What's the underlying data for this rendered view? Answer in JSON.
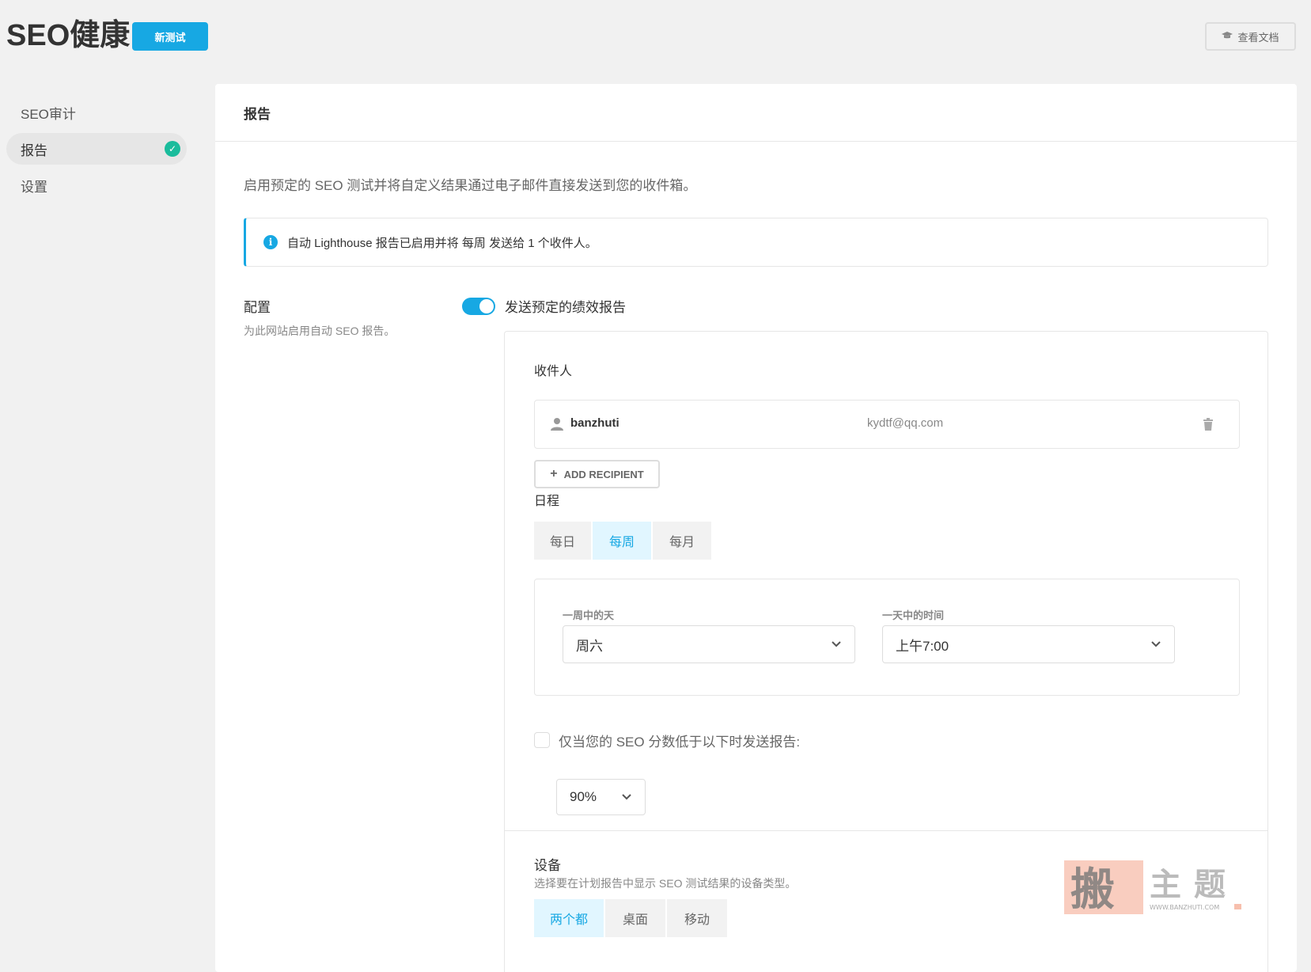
{
  "header": {
    "title": "SEO健康",
    "new_test_label": "新测试",
    "docs_label": "查看文档"
  },
  "sidebar": {
    "items": [
      {
        "label": "SEO审计"
      },
      {
        "label": "报告"
      },
      {
        "label": "设置"
      }
    ]
  },
  "main": {
    "title": "报告",
    "intro": "启用预定的 SEO 测试并将自定义结果通过电子邮件直接发送到您的收件箱。",
    "notice": "自动 Lighthouse 报告已启用并将 每周 发送给 1 个收件人。",
    "config": {
      "label": "配置",
      "desc": "为此网站启用自动 SEO 报告。",
      "toggle_label": "发送预定的绩效报告"
    },
    "recipients": {
      "label": "收件人",
      "items": [
        {
          "name": "banzhuti",
          "email": "kydtf@qq.com"
        }
      ],
      "add_label": "ADD RECIPIENT"
    },
    "schedule": {
      "label": "日程",
      "tabs": [
        "每日",
        "每周",
        "每月"
      ],
      "selected": "每周",
      "day_label": "一周中的天",
      "day_value": "周六",
      "time_label": "一天中的时间",
      "time_value": "上午7:00"
    },
    "threshold": {
      "label": "仅当您的 SEO 分数低于以下时发送报告:",
      "value": "90%"
    },
    "devices": {
      "label": "设备",
      "desc": "选择要在计划报告中显示 SEO 测试结果的设备类型。",
      "tabs": [
        "两个都",
        "桌面",
        "移动"
      ],
      "selected": "两个都"
    }
  },
  "watermark": {
    "text": "搬主题",
    "url": "WWW.BANZHUTI.COM"
  },
  "colors": {
    "accent": "#17a8e3",
    "success": "#1abc9c",
    "selected_tab_bg": "#e1f6ff"
  }
}
